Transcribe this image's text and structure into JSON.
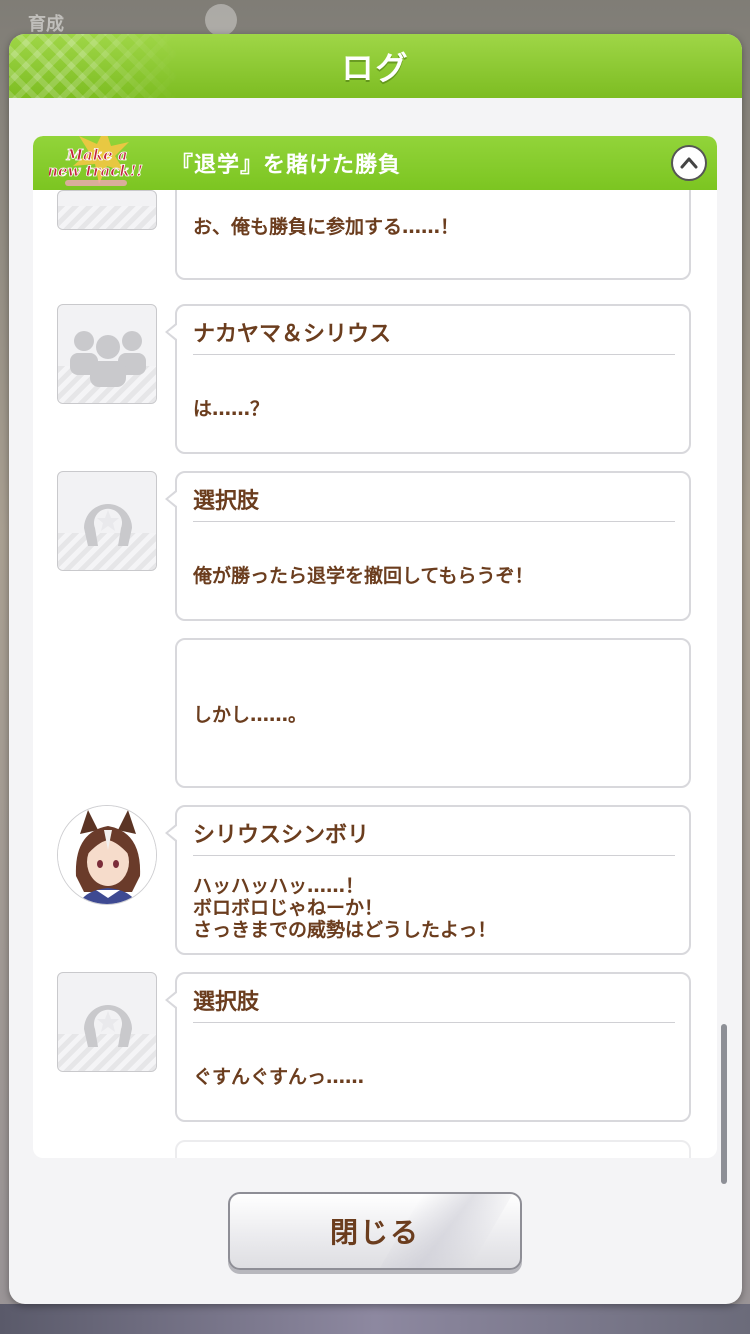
{
  "background": {
    "top_label": "育成"
  },
  "modal": {
    "title": "ログ"
  },
  "chapter": {
    "logo_text_line1": "Make a",
    "logo_text_line2": "new track!!",
    "title": "『退学』を賭けた勝負"
  },
  "entries": [
    {
      "speaker": "",
      "text": "お、俺も勝負に参加する……！",
      "avatar": "generic-user-icon",
      "truncated_top": true
    },
    {
      "speaker": "ナカヤマ＆シリウス",
      "text": "は……？",
      "avatar": "group-icon"
    },
    {
      "speaker": "選択肢",
      "text": "俺が勝ったら退学を撤回してもらうぞ！",
      "avatar": "horseshoe-icon"
    },
    {
      "speaker": "",
      "text": "しかし……。",
      "avatar": ""
    },
    {
      "speaker": "シリウスシンボリ",
      "text": "ハッハッハッ……！\nボロボロじゃねーか！\nさっきまでの威勢はどうしたよっ！",
      "avatar": "character-portrait"
    },
    {
      "speaker": "選択肢",
      "text": "ぐすんぐすんっ……",
      "avatar": "horseshoe-icon"
    }
  ],
  "footer": {
    "close_label": "閉じる"
  },
  "colors": {
    "header_green": "#8cc833",
    "text_brown": "#6b3d1e",
    "panel_bg": "#ffffff"
  }
}
